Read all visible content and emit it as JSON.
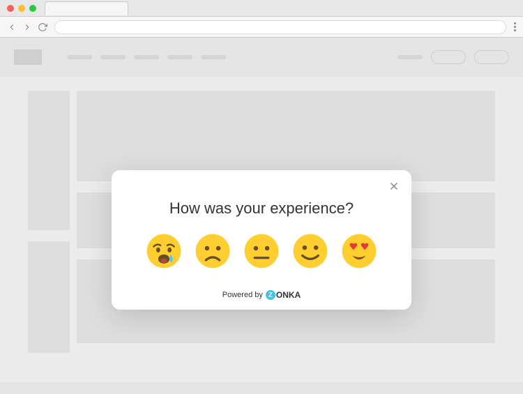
{
  "modal": {
    "question": "How was your experience?",
    "powered_by_prefix": "Powered by",
    "brand_name": "ONKA",
    "brand_initial": "Z",
    "ratings": [
      {
        "name": "very-unhappy",
        "label": "Very unhappy"
      },
      {
        "name": "unhappy",
        "label": "Unhappy"
      },
      {
        "name": "neutral",
        "label": "Neutral"
      },
      {
        "name": "happy",
        "label": "Happy"
      },
      {
        "name": "love",
        "label": "Love it"
      }
    ]
  }
}
